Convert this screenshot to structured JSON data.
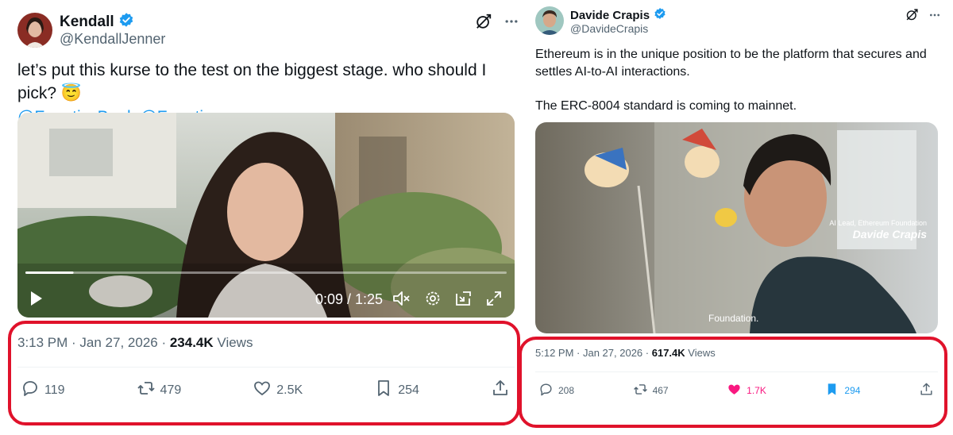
{
  "left": {
    "author": {
      "name": "Kendall",
      "handle": "@KendallJenner"
    },
    "text_line1": "let’s put this kurse to the test on the biggest stage. who should I pick?",
    "emoji": "😇",
    "mentions": [
      "@FanaticsBook",
      "@Fanatics"
    ],
    "video": {
      "time": "0:09 / 1:25",
      "progress": 0.1
    },
    "meta": {
      "time": "3:13 PM",
      "date": "Jan 27, 2026",
      "views": "234.4K",
      "views_label": "Views"
    },
    "actions": {
      "replies": "119",
      "reposts": "479",
      "likes": "2.5K",
      "bookmarks": "254"
    },
    "icons": [
      "grok-icon",
      "more-icon",
      "play-icon",
      "mute-icon",
      "settings-icon",
      "pip-icon",
      "fullscreen-icon",
      "reply-icon",
      "repost-icon",
      "like-icon",
      "bookmark-icon",
      "share-icon"
    ]
  },
  "right": {
    "author": {
      "name": "Davide Crapis",
      "handle": "@DavideCrapis"
    },
    "text_line1": "Ethereum is in the unique position to be the platform that secures and",
    "text_line2": "settles AI-to-AI interactions.",
    "text_line3": "The ERC-8004 standard is coming to mainnet.",
    "video_overlay": {
      "role": "AI Lead, Ethereum Foundation",
      "name": "Davide Crapis",
      "caption": "Foundation."
    },
    "meta": {
      "time": "5:12 PM",
      "date": "Jan 27, 2026",
      "views": "617.4K",
      "views_label": "Views"
    },
    "actions": {
      "replies": "208",
      "reposts": "467",
      "likes": "1.7K",
      "bookmarks": "294"
    }
  },
  "colors": {
    "link": "#1d9bf0",
    "verified": "#1d9bf0",
    "highlight": "#e0122b",
    "liked": "#f91880",
    "bookmarked": "#1d9bf0"
  }
}
